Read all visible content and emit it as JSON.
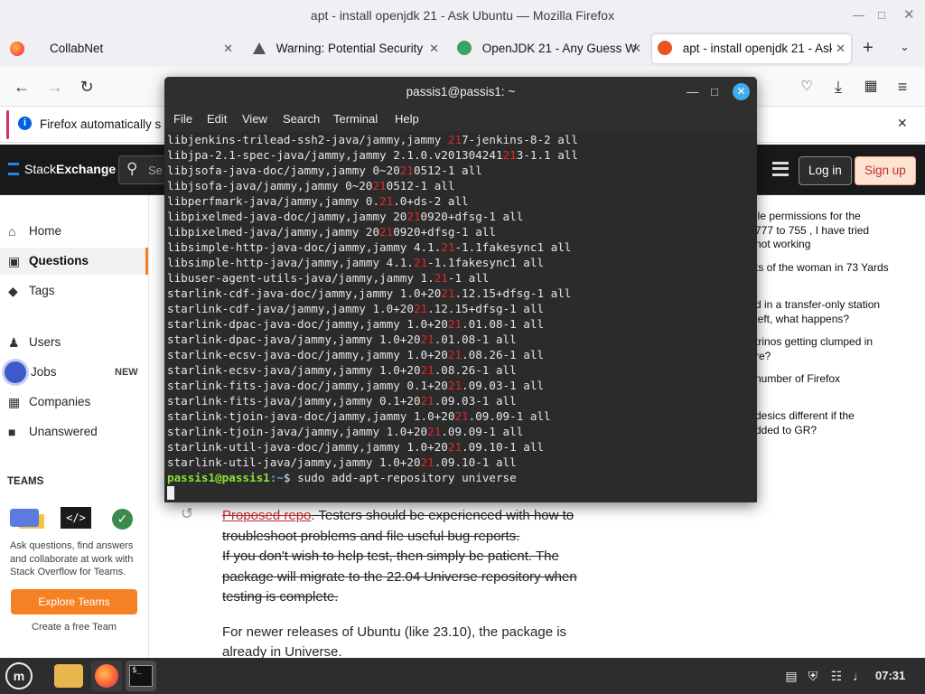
{
  "window": {
    "title": "apt - install openjdk 21 - Ask Ubuntu — Mozilla Firefox"
  },
  "tabs": [
    {
      "label": "CollabNet",
      "active": false
    },
    {
      "label": "Warning: Potential Security",
      "active": false
    },
    {
      "label": "OpenJDK 21 - Any Guess W",
      "active": false
    },
    {
      "label": "apt - install openjdk 21 - Ask",
      "active": true
    }
  ],
  "notification": {
    "text": "Firefox automatically s"
  },
  "site": {
    "logo_stack": "Stack",
    "logo_exchange": "Exchange",
    "search_placeholder": "Se",
    "login": "Log in",
    "signup": "Sign up"
  },
  "sidebar": {
    "items": [
      {
        "label": "Home"
      },
      {
        "label": "Questions"
      },
      {
        "label": "Tags"
      },
      {
        "label": "Users"
      },
      {
        "label": "Jobs",
        "badge": "NEW"
      },
      {
        "label": "Companies"
      },
      {
        "label": "Unanswered"
      }
    ],
    "teams_heading": "TEAMS",
    "teams_blurb": "Ask questions, find answers and collaborate at work with Stack Overflow for Teams.",
    "explore_button": "Explore Teams",
    "create_link": "Create a free Team"
  },
  "hot_questions": [
    {
      "text": "ile permissions for the\n777 to 755 , I have tried\nnot working"
    },
    {
      "text": "ts of the woman in 73 Yards"
    },
    {
      "text": "d in a transfer-only station\nleft, what happens?"
    },
    {
      "text": "trinos getting clumped in\nre?"
    },
    {
      "text": "number of Firefox"
    },
    {
      "text": "desics different if the\ndded to GR?"
    }
  ],
  "answer": {
    "link": "Proposed repo",
    "line1_rest": ". Testers should be experienced with how to",
    "line2": "troubleshoot problems and file useful bug reports.",
    "line3": "If you don't wish to help test, then simply be patient. The",
    "line4": "package will migrate to the 22.04 Universe repository when",
    "line5": "testing is complete.",
    "line6": "For newer releases of Ubuntu (like 23.10), the package is",
    "line7": "already in Universe."
  },
  "terminal": {
    "title": "passis1@passis1: ~",
    "menu": [
      "File",
      "Edit",
      "View",
      "Search",
      "Terminal",
      "Help"
    ],
    "lines": [
      [
        "libjenkins-trilead-ssh2-java/jammy,jammy ",
        "21",
        "7-jenkins-8-2 all"
      ],
      [
        "libjpa-2.1-spec-java/jammy,jammy 2.1.0.v201304241",
        "21",
        "3-1.1 all"
      ],
      [
        "libjsofa-java-doc/jammy,jammy 0~20",
        "21",
        "0512-1 all"
      ],
      [
        "libjsofa-java/jammy,jammy 0~20",
        "21",
        "0512-1 all"
      ],
      [
        "libperfmark-java/jammy,jammy 0.",
        "21",
        ".0+ds-2 all"
      ],
      [
        "libpixelmed-java-doc/jammy,jammy 20",
        "21",
        "0920+dfsg-1 all"
      ],
      [
        "libpixelmed-java/jammy,jammy 20",
        "21",
        "0920+dfsg-1 all"
      ],
      [
        "libsimple-http-java-doc/jammy,jammy 4.1.",
        "21",
        "-1.1fakesync1 all"
      ],
      [
        "libsimple-http-java/jammy,jammy 4.1.",
        "21",
        "-1.1fakesync1 all"
      ],
      [
        "libuser-agent-utils-java/jammy,jammy 1.",
        "21",
        "-1 all"
      ],
      [
        "starlink-cdf-java-doc/jammy,jammy 1.0+20",
        "21",
        ".12.15+dfsg-1 all"
      ],
      [
        "starlink-cdf-java/jammy,jammy 1.0+20",
        "21",
        ".12.15+dfsg-1 all"
      ],
      [
        "starlink-dpac-java-doc/jammy,jammy 1.0+20",
        "21",
        ".01.08-1 all"
      ],
      [
        "starlink-dpac-java/jammy,jammy 1.0+20",
        "21",
        ".01.08-1 all"
      ],
      [
        "starlink-ecsv-java-doc/jammy,jammy 1.0+20",
        "21",
        ".08.26-1 all"
      ],
      [
        "starlink-ecsv-java/jammy,jammy 1.0+20",
        "21",
        ".08.26-1 all"
      ],
      [
        "starlink-fits-java-doc/jammy,jammy 0.1+20",
        "21",
        ".09.03-1 all"
      ],
      [
        "starlink-fits-java/jammy,jammy 0.1+20",
        "21",
        ".09.03-1 all"
      ],
      [
        "starlink-tjoin-java-doc/jammy,jammy 1.0+20",
        "21",
        ".09.09-1 all"
      ],
      [
        "starlink-tjoin-java/jammy,jammy 1.0+20",
        "21",
        ".09.09-1 all"
      ],
      [
        "starlink-util-java-doc/jammy,jammy 1.0+20",
        "21",
        ".09.10-1 all"
      ],
      [
        "starlink-util-java/jammy,jammy 1.0+20",
        "21",
        ".09.10-1 all"
      ]
    ],
    "prompt_user": "passis1@passis1",
    "prompt_path": ":~",
    "prompt_symbol": "$",
    "command": "sudo add-apt-repository universe"
  },
  "taskbar": {
    "clock": "07:31"
  },
  "colors": {
    "so_orange": "#f48225",
    "term_bg": "#2b2b2b",
    "highlight": "#e02828",
    "prompt_green": "#8ae234"
  }
}
